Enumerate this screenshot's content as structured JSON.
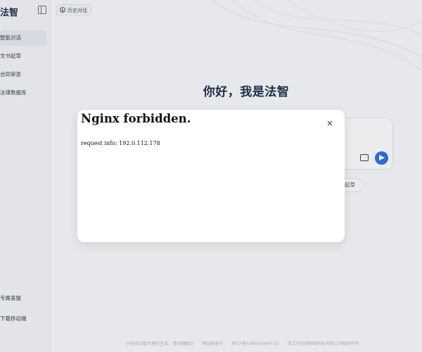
{
  "sidebar": {
    "brand": "法智",
    "items": [
      {
        "label": "智能对话",
        "active": true
      },
      {
        "label": "文书起草",
        "active": false
      },
      {
        "label": "合同审查",
        "active": false
      },
      {
        "label": "法律数据库",
        "active": false
      }
    ],
    "bottom": [
      {
        "label": "专属客服"
      },
      {
        "label": "下载移动端"
      }
    ]
  },
  "header": {
    "history_label": "历史对话"
  },
  "main": {
    "greeting": "你好，我是法智",
    "chip_label": "起草"
  },
  "footer": {
    "items": [
      "内容由法智大模型生成，请仔细甄别",
      "网站备案号",
      "浙ICP备19956398号-35",
      "浙江同花顺网络科技有限公司版权所有"
    ]
  },
  "modal": {
    "title": "Nginx forbidden.",
    "body": "request info: 192.0.112.178",
    "close_glyph": "×"
  },
  "colors": {
    "accent": "#2f6fd6",
    "heading": "#1f2d4d"
  }
}
